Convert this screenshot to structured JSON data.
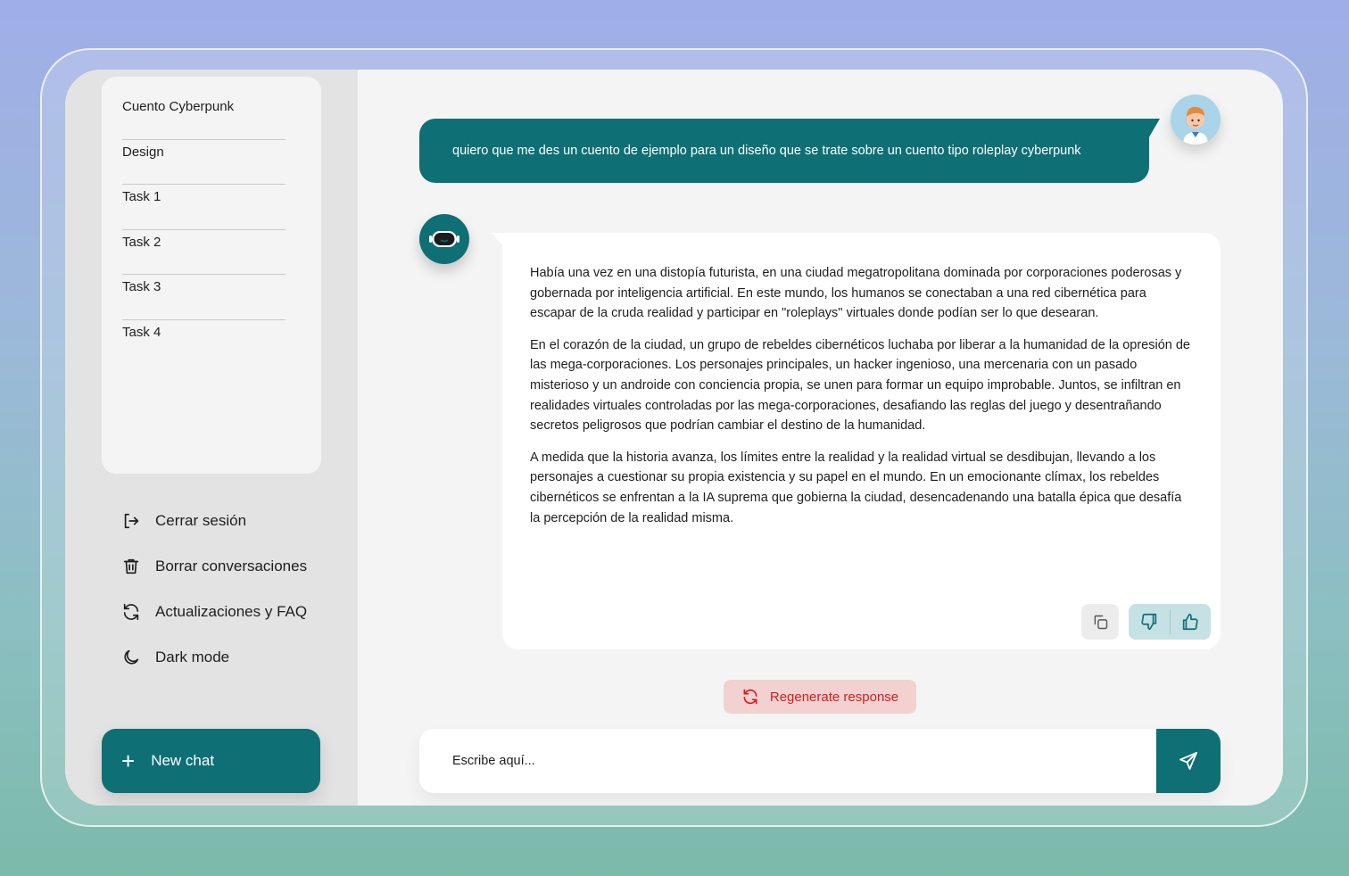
{
  "sidebar": {
    "conversations": [
      {
        "label": "Cuento Cyberpunk"
      },
      {
        "label": "Design"
      },
      {
        "label": "Task 1"
      },
      {
        "label": "Task 2"
      },
      {
        "label": "Task 3"
      },
      {
        "label": "Task 4"
      }
    ],
    "menu": {
      "logout": {
        "label": "Cerrar sesión",
        "icon": "logout-icon"
      },
      "delete": {
        "label": "Borrar conversaciones",
        "icon": "trash-icon"
      },
      "updates": {
        "label": "Actualizaciones y FAQ",
        "icon": "refresh-icon"
      },
      "dark": {
        "label": "Dark mode",
        "icon": "moon-icon"
      }
    },
    "new_chat": {
      "label": "New chat",
      "icon": "plus-icon"
    }
  },
  "chat": {
    "user_message": "quiero que me des un cuento de ejemplo para un diseño que se trate sobre un cuento tipo roleplay cyberpunk",
    "bot_paragraphs": [
      "Había una vez en una distopía futurista, en una ciudad megatropolitana dominada por corporaciones poderosas y gobernada por inteligencia artificial. En este mundo, los humanos se conectaban a una red cibernética para escapar de la cruda realidad y participar en \"roleplays\" virtuales donde podían ser lo que desearan.",
      "En el corazón de la ciudad, un grupo de rebeldes cibernéticos luchaba por liberar a la humanidad de la opresión de las mega-corporaciones. Los personajes principales, un hacker ingenioso, una mercenaria con un pasado misterioso y un androide con conciencia propia, se unen para formar un equipo improbable. Juntos, se infiltran en realidades virtuales controladas por las mega-corporaciones, desafiando las reglas del juego y desentrañando secretos peligrosos que podrían cambiar el destino de la humanidad.",
      "A medida que la historia avanza, los límites entre la realidad y la realidad virtual se desdibujan, llevando a los personajes a cuestionar su propia existencia y su papel en el mundo. En un emocionante clímax, los rebeldes cibernéticos se enfrentan a la IA suprema que gobierna la ciudad, desencadenando una batalla épica que desafía la percepción de la realidad misma."
    ],
    "regenerate_label": "Regenerate response",
    "input_placeholder": "Escribe aquí..."
  },
  "colors": {
    "accent": "#0e6f74",
    "regenerate_bg": "#f3d1d1",
    "regenerate_text": "#d21e1e",
    "vote_bg": "#c6e1e3"
  }
}
